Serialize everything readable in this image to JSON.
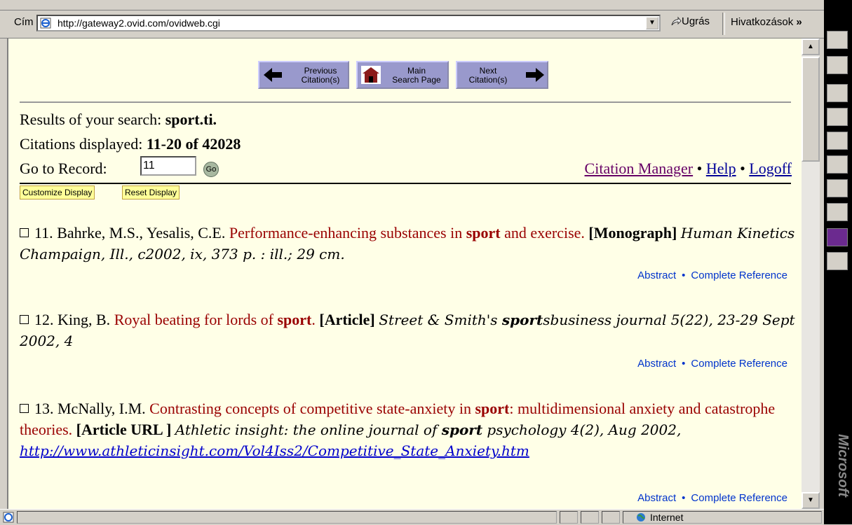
{
  "address_bar": {
    "label": "Cím",
    "url": "http://gateway2.ovid.com/ovidweb.cgi",
    "go_label": "Ugrás",
    "links_label": "Hivatkozások",
    "chevron": "»"
  },
  "nav": {
    "previous": "Previous\nCitation(s)",
    "main": "Main\nSearch Page",
    "next": "Next\nCitation(s)"
  },
  "search": {
    "results_prefix": "Results of your search:",
    "results_query": "sport.ti.",
    "citations_prefix": "Citations displayed:",
    "citations_range": "11-20 of 42028",
    "goto_label": "Go to Record:",
    "goto_value": "11",
    "go_button": "Go"
  },
  "top_links": {
    "citation_manager": "Citation Manager",
    "help": "Help",
    "logoff": "Logoff",
    "bullet": "•"
  },
  "display_buttons": {
    "customize": "Customize Display",
    "reset": "Reset Display"
  },
  "records": [
    {
      "number": "11.",
      "authors": "Bahrke, M.S., Yesalis, C.E.",
      "title_pre": "Performance-enhancing substances in ",
      "title_bold": "sport",
      "title_post": " and exercise.",
      "type": "[Monograph]",
      "source": "Human Kinetics Champaign, Ill., c2002, ix, 373 p. : ill.; 29 cm."
    },
    {
      "number": "12.",
      "authors": "King, B.",
      "title_pre": "Royal beating for lords of ",
      "title_bold": "sport",
      "title_post": ".",
      "type": "[Article]",
      "source_pre": "Street & Smith's ",
      "source_bold": "sport",
      "source_post": "sbusiness journal 5(22), 23-29 Sept 2002, 4"
    },
    {
      "number": "13.",
      "authors": "McNally, I.M.",
      "title_pre": "Contrasting concepts of competitive state-anxiety in ",
      "title_bold": "sport",
      "title_post": ": multidimensional anxiety and catastrophe theories.",
      "type": "[Article URL ]",
      "source_pre": "Athletic insight: the online journal of ",
      "source_bold": "sport",
      "source_post": " psychology 4(2), Aug 2002,",
      "url": "http://www.athleticinsight.com/Vol4Iss2/Competitive_State_Anxiety.htm"
    }
  ],
  "record_links": {
    "abstract": "Abstract",
    "complete": "Complete Reference",
    "bullet": "•"
  },
  "statusbar": {
    "zone": "Internet"
  },
  "sidebar_brand": "Microsoft"
}
